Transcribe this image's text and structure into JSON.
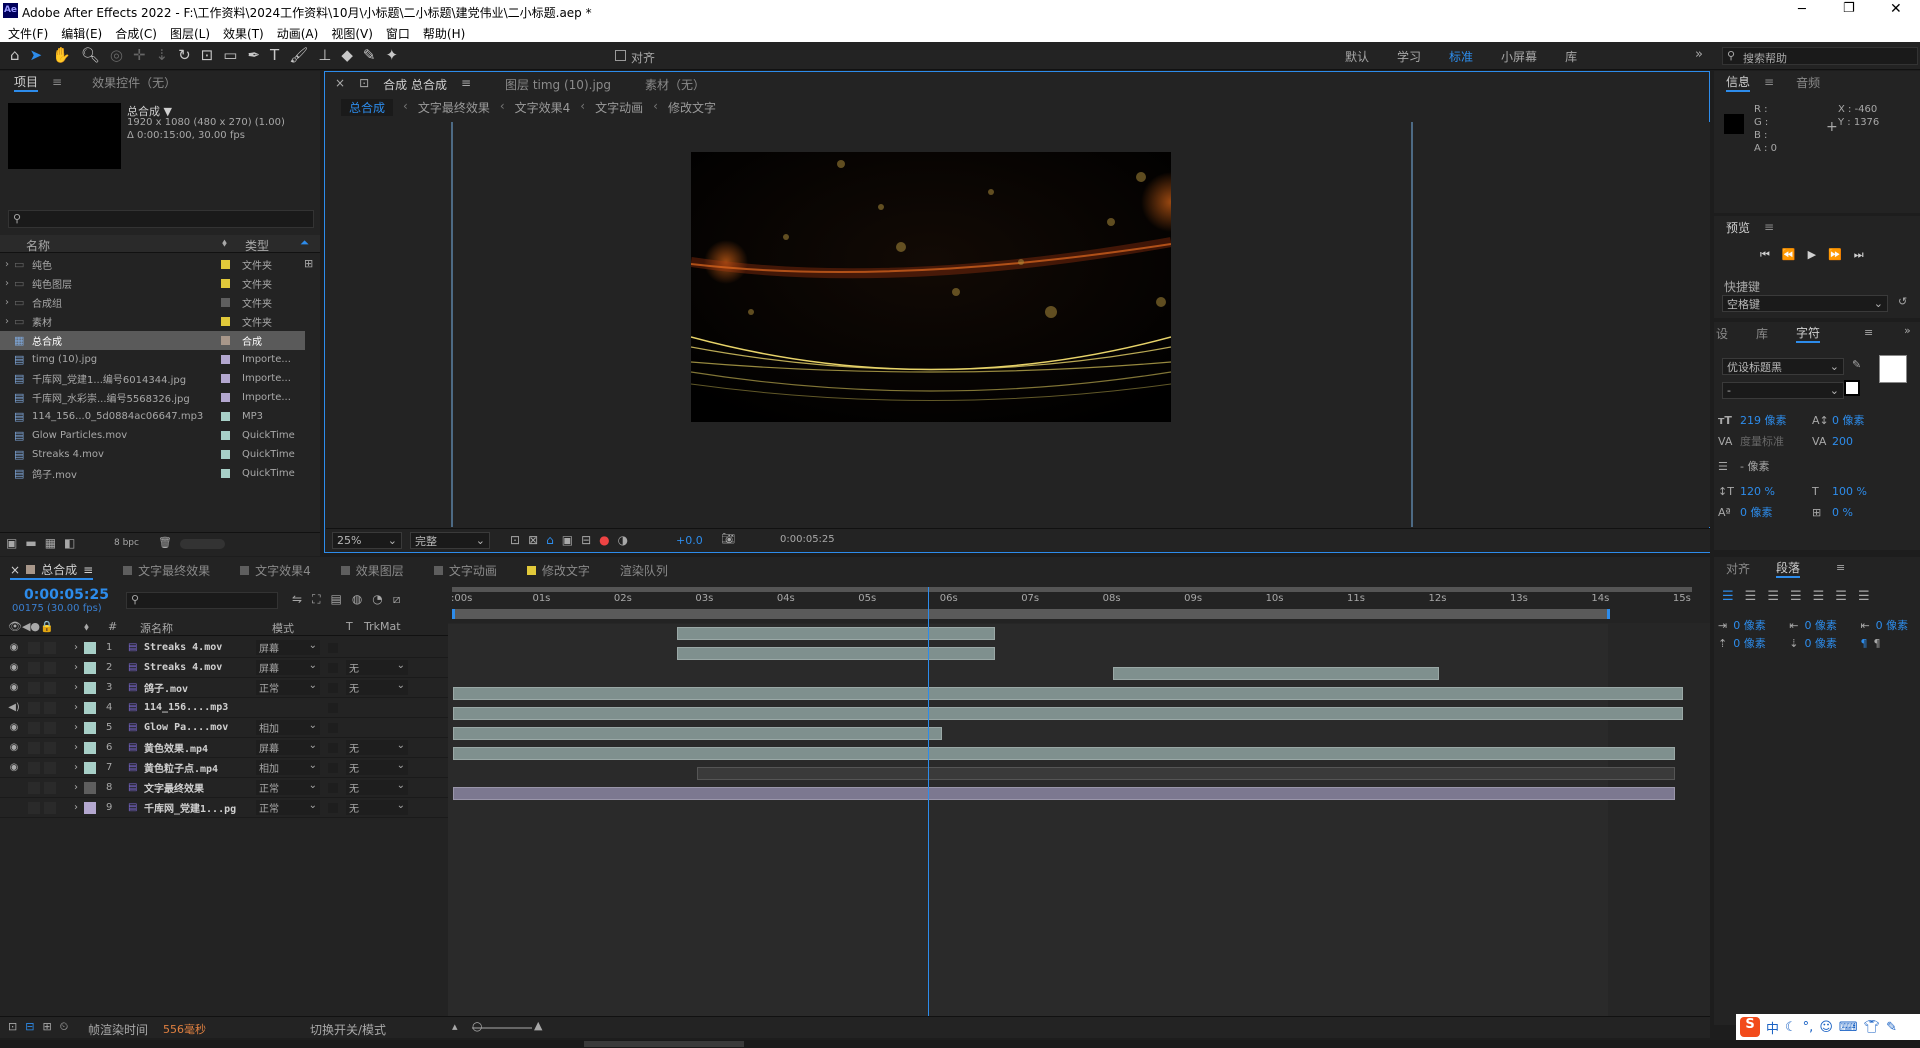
{
  "app": {
    "title": "Adobe After Effects 2022 - F:\\工作资料\\2024工作资料\\10月\\小标题\\二小标题\\建党伟业\\二小标题.aep *",
    "logo": "Ae"
  },
  "menu": [
    "文件(F)",
    "编辑(E)",
    "合成(C)",
    "图层(L)",
    "效果(T)",
    "动画(A)",
    "视图(V)",
    "窗口",
    "帮助(H)"
  ],
  "toolbar": {
    "align_label": "对齐",
    "workspaces": [
      "默认",
      "学习",
      "标准",
      "小屏幕",
      "库"
    ],
    "active_workspace": "标准",
    "search_placeholder": "搜索帮助"
  },
  "project": {
    "tabs": [
      "项目",
      "效果控件（无）"
    ],
    "comp_name": "总合成 ▼",
    "comp_info1": "1920 x 1080  (480 x 270) (1.00)",
    "comp_info2": "Δ 0:00:15:00, 30.00 fps",
    "col_name": "名称",
    "col_type": "类型",
    "bpc": "8 bpc",
    "items": [
      {
        "name": "纯色",
        "type": "文件夹",
        "color": "#e1c93a",
        "kind": "folder"
      },
      {
        "name": "纯色图层",
        "type": "文件夹",
        "color": "#e1c93a",
        "kind": "folder"
      },
      {
        "name": "合成组",
        "type": "文件夹",
        "color": "#5e5e5e",
        "kind": "folder"
      },
      {
        "name": "素材",
        "type": "文件夹",
        "color": "#e1c93a",
        "kind": "folder"
      },
      {
        "name": "总合成",
        "type": "合成",
        "color": "#a8978a",
        "kind": "comp"
      },
      {
        "name": "timg (10).jpg",
        "type": "Importe...",
        "color": "#b3a7cf",
        "kind": "file"
      },
      {
        "name": "千库网_党建1...编号6014344.jpg",
        "type": "Importe...",
        "color": "#b3a7cf",
        "kind": "file"
      },
      {
        "name": "千库网_水彩崇...编号5568326.jpg",
        "type": "Importe...",
        "color": "#b3a7cf",
        "kind": "file"
      },
      {
        "name": "114_156...0_5d0884ac06647.mp3",
        "type": "MP3",
        "color": "#a7cfc7",
        "kind": "file"
      },
      {
        "name": "Glow Particles.mov",
        "type": "QuickTime",
        "color": "#a7cfc7",
        "kind": "file"
      },
      {
        "name": "Streaks 4.mov",
        "type": "QuickTime",
        "color": "#a7cfc7",
        "kind": "file"
      },
      {
        "name": "鸽子.mov",
        "type": "QuickTime",
        "color": "#a7cfc7",
        "kind": "file"
      }
    ]
  },
  "viewer": {
    "tabs": [
      "合成 总合成",
      "图层 timg (10).jpg",
      "素材（无）"
    ],
    "breadcrumbs": [
      "总合成",
      "文字最终效果",
      "文字效果4",
      "文字动画",
      "修改文字"
    ],
    "zoom": "25%",
    "quality": "完整",
    "exposure": "+0.0",
    "timecode": "0:00:05:25"
  },
  "info": {
    "tabs": [
      "信息",
      "音频"
    ],
    "r": "R :",
    "g": "G :",
    "b": "B :",
    "a": "A : 0",
    "x": "X : -460",
    "y": "Y : 1376"
  },
  "preview": {
    "title": "预览",
    "shortcut_label": "快捷键",
    "shortcut_value": "空格键"
  },
  "character": {
    "tabs": [
      "设",
      "库",
      "字符"
    ],
    "font": "优设标题黑",
    "style": "-",
    "size": "219 像素",
    "leading": "0 像素",
    "kerning": "度量标准",
    "tracking": "200",
    "stroke": "- 像素",
    "vscale": "120 %",
    "hscale": "100 %",
    "baseline": "0 像素",
    "tsume": "0 %"
  },
  "paragraph": {
    "tabs": [
      "对齐",
      "段落"
    ],
    "indent": "0 像素"
  },
  "timeline": {
    "tabs": [
      "总合成",
      "文字最终效果",
      "文字效果4",
      "效果图层",
      "文字动画",
      "修改文字",
      "渲染队列"
    ],
    "timecode": "0:00:05:25",
    "frames": "00175 (30.00 fps)",
    "col_source": "源名称",
    "col_mode": "模式",
    "col_t": "T",
    "col_trkmat": "TrkMat",
    "ticks": [
      ":00s",
      "01s",
      "02s",
      "03s",
      "04s",
      "05s",
      "06s",
      "07s",
      "08s",
      "09s",
      "10s",
      "11s",
      "12s",
      "13s",
      "14s",
      "15s"
    ],
    "current_time_s": 5.83,
    "duration_s": 15,
    "layers": [
      {
        "num": "1",
        "name": "Streaks 4.mov",
        "mode": "屏幕",
        "trk": "",
        "color": "#a7cfc7",
        "start": 2.75,
        "end": 6.65,
        "vis": true
      },
      {
        "num": "2",
        "name": "Streaks 4.mov",
        "mode": "屏幕",
        "trk": "无",
        "color": "#a7cfc7",
        "start": 2.75,
        "end": 6.65,
        "vis": true
      },
      {
        "num": "3",
        "name": "鸽子.mov",
        "mode": "正常",
        "trk": "无",
        "color": "#a7cfc7",
        "start": 8.1,
        "end": 12.1,
        "vis": true
      },
      {
        "num": "4",
        "name": "114_156....mp3",
        "mode": "",
        "trk": "",
        "color": "#a7cfc7",
        "start": 0,
        "end": 15.1,
        "vis": false
      },
      {
        "num": "5",
        "name": "Glow Pa....mov",
        "mode": "相加",
        "trk": "",
        "color": "#a7cfc7",
        "start": 0,
        "end": 15.1,
        "vis": true
      },
      {
        "num": "6",
        "name": "黄色效果.mp4",
        "mode": "屏幕",
        "trk": "无",
        "color": "#a7cfc7",
        "start": 0,
        "end": 6.0,
        "vis": true
      },
      {
        "num": "7",
        "name": "黄色粒子点.mp4",
        "mode": "相加",
        "trk": "无",
        "color": "#a7cfc7",
        "start": 0,
        "end": 15.0,
        "vis": true
      },
      {
        "num": "8",
        "name": "文字最终效果",
        "mode": "正常",
        "trk": "无",
        "color": "#5e5e5e",
        "start": 3.0,
        "end": 15.0,
        "vis": false
      },
      {
        "num": "9",
        "name": "千库网_党建1...pg",
        "mode": "正常",
        "trk": "无",
        "color": "#b3a7cf",
        "start": 0,
        "end": 15.0,
        "vis": false
      }
    ],
    "render_time_label": "帧渲染时间",
    "render_time_value": "556毫秒",
    "toggle_label": "切换开关/模式"
  },
  "taskbar": {
    "ime": "中"
  }
}
